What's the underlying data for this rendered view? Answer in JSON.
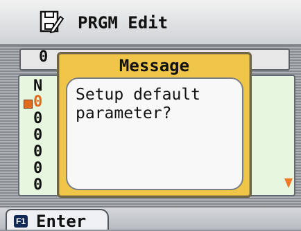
{
  "header": {
    "title": "PRGM Edit",
    "icon_name": "edit-document-icon"
  },
  "background": {
    "top_bar_text": "0",
    "list_first_item_partial": "N",
    "list_items_partial": [
      "0",
      "0",
      "0",
      "0",
      "0",
      "0"
    ]
  },
  "dialog": {
    "title": "Message",
    "message_lines": [
      "Setup default",
      "parameter?"
    ]
  },
  "footer": {
    "key_badge": "F1",
    "action_label": "Enter"
  },
  "colors": {
    "accent": "#efc64a",
    "marker": "#e06a1d",
    "panel_bg": "#e6f6df"
  }
}
